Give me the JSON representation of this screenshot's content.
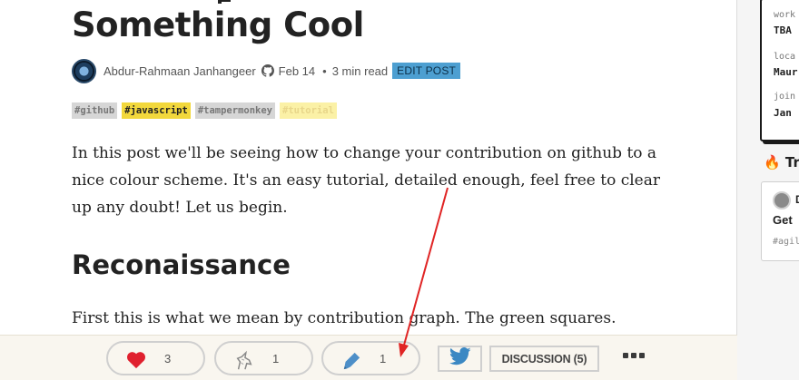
{
  "article": {
    "title": "Something Cool",
    "author": "Abdur-Rahmaan Janhangeer",
    "date": "Feb 14",
    "separator": "•",
    "read_time": "3 min read",
    "edit_label": "EDIT POST",
    "tags": [
      {
        "label": "#github",
        "style": "gray"
      },
      {
        "label": "#javascript",
        "style": "js"
      },
      {
        "label": "#tampermonkey",
        "style": "gray"
      },
      {
        "label": "#tutorial",
        "style": "faded"
      }
    ],
    "intro": "In this post we'll be seeing how to change your contribution on github to a nice colour scheme. It's an easy tutorial, detailed enough, feel free to clear up any doubt! Let us begin.",
    "heading": "Reconaissance",
    "paragraph2": "First this is what we mean by contribution graph. The green squares."
  },
  "reactions": {
    "heart": {
      "icon": "heart-icon",
      "count": "3"
    },
    "unicorn": {
      "icon": "unicorn-icon",
      "count": "1"
    },
    "bookmark": {
      "icon": "bookmark-icon",
      "count": "1"
    }
  },
  "actions": {
    "twitter_icon": "twitter-icon",
    "discussion_label": "DISCUSSION (5)",
    "more_icon": "more-icon"
  },
  "sidebar": {
    "profile": [
      {
        "label": "work",
        "value": "TBA"
      },
      {
        "label": "loca",
        "value": "Maur"
      },
      {
        "label": "join",
        "value": "Jan"
      }
    ],
    "trending_title": "🔥 Tr",
    "trending_card": {
      "author": "D",
      "title": "Get",
      "tag": "#agil"
    }
  },
  "colors": {
    "heart": "#e0202e",
    "twitter": "#1da1f2",
    "edit_post_bg": "#4d9fd1",
    "tag_js_bg": "#f2d83c",
    "arrow": "#e02424"
  }
}
